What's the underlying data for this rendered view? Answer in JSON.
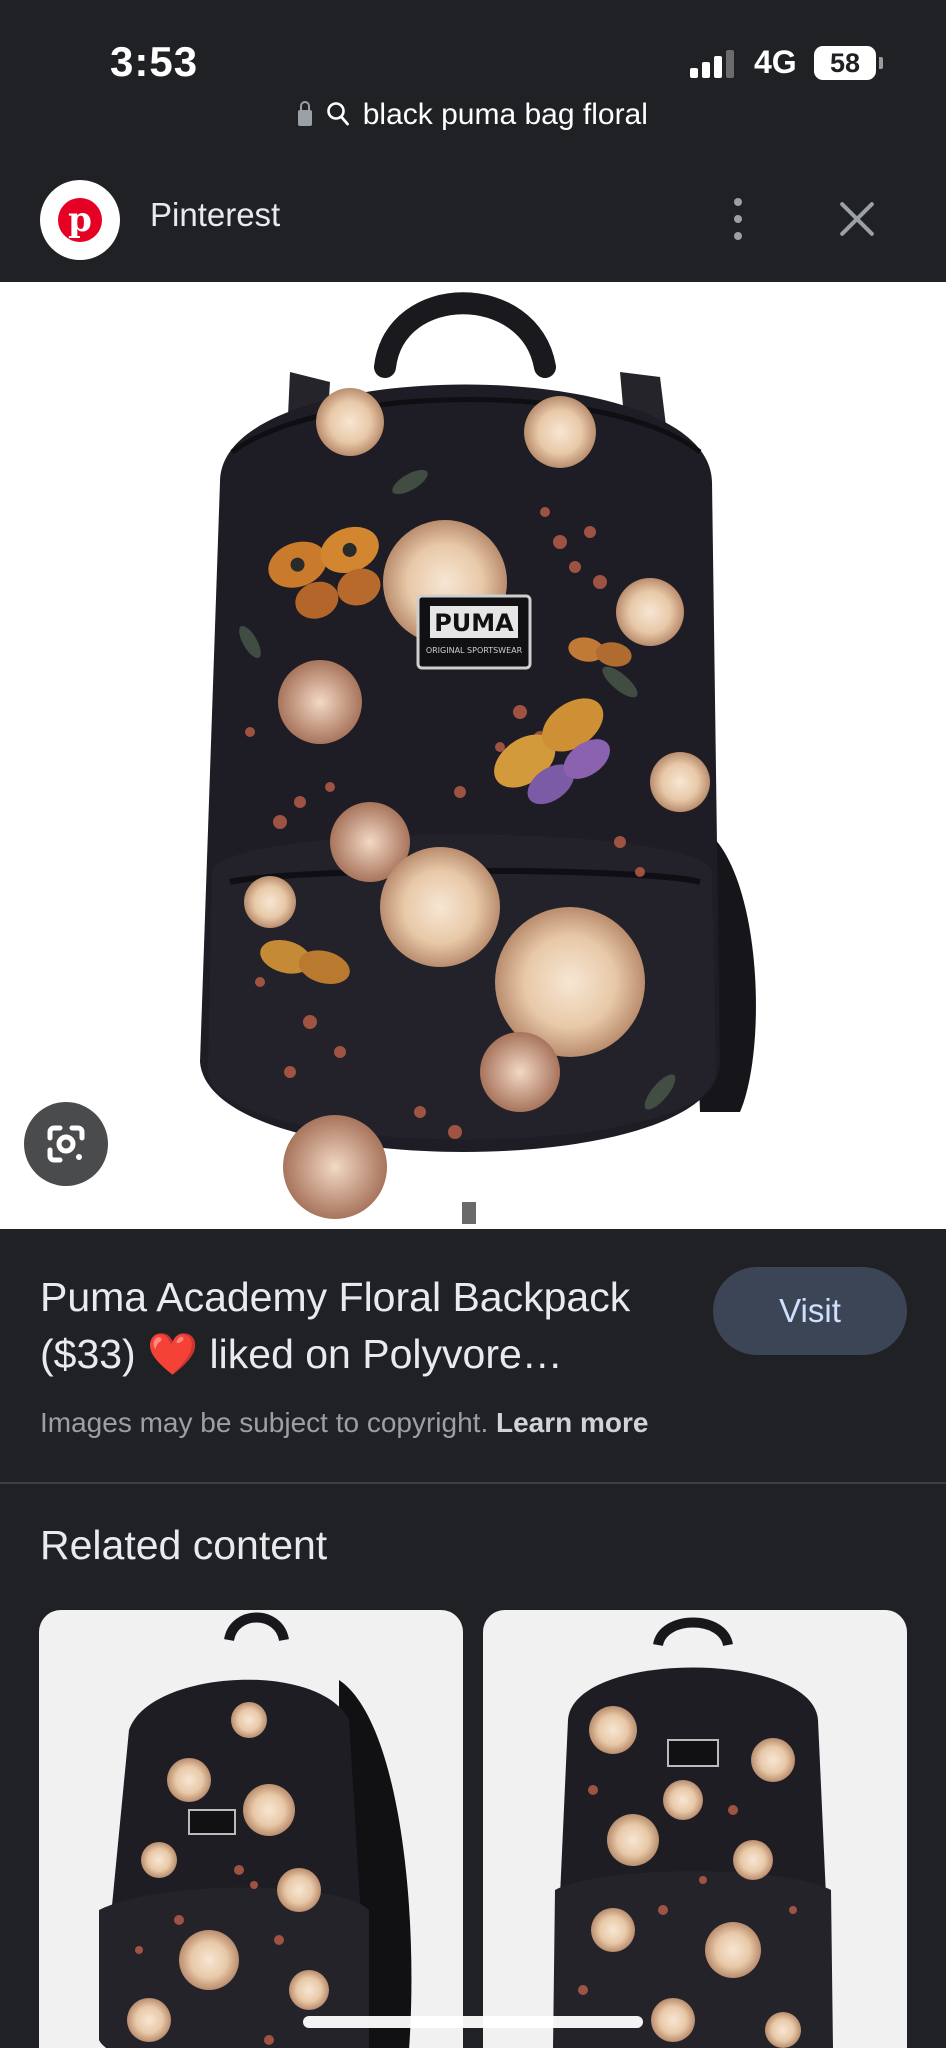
{
  "status_bar": {
    "time": "3:53",
    "network": "4G",
    "battery": "58",
    "signal_bars": 3
  },
  "url_bar": {
    "query": "black puma bag floral",
    "icons": [
      "lock-icon",
      "search-icon"
    ]
  },
  "source": {
    "name": "Pinterest",
    "logo": "pinterest-logo",
    "logo_letter": "p",
    "brand_color": "#e60023"
  },
  "hero": {
    "brand_patch": "PUMA",
    "patch_subtitle": "ORIGINAL SPORTSWEAR"
  },
  "result": {
    "title": "Puma Academy Floral Backpack ($33) ❤️ liked on Polyvore…",
    "visit_label": "Visit",
    "copyright_text": "Images may be subject to copyright.",
    "learn_more_label": "Learn more"
  },
  "related": {
    "title": "Related content",
    "cards": [
      {
        "image": "floral-backpack-side-view"
      },
      {
        "image": "floral-backpack-front-view"
      }
    ]
  },
  "colors": {
    "background": "#202124",
    "visit_button": "#3c4555",
    "muted_text": "#9aa0a6"
  }
}
